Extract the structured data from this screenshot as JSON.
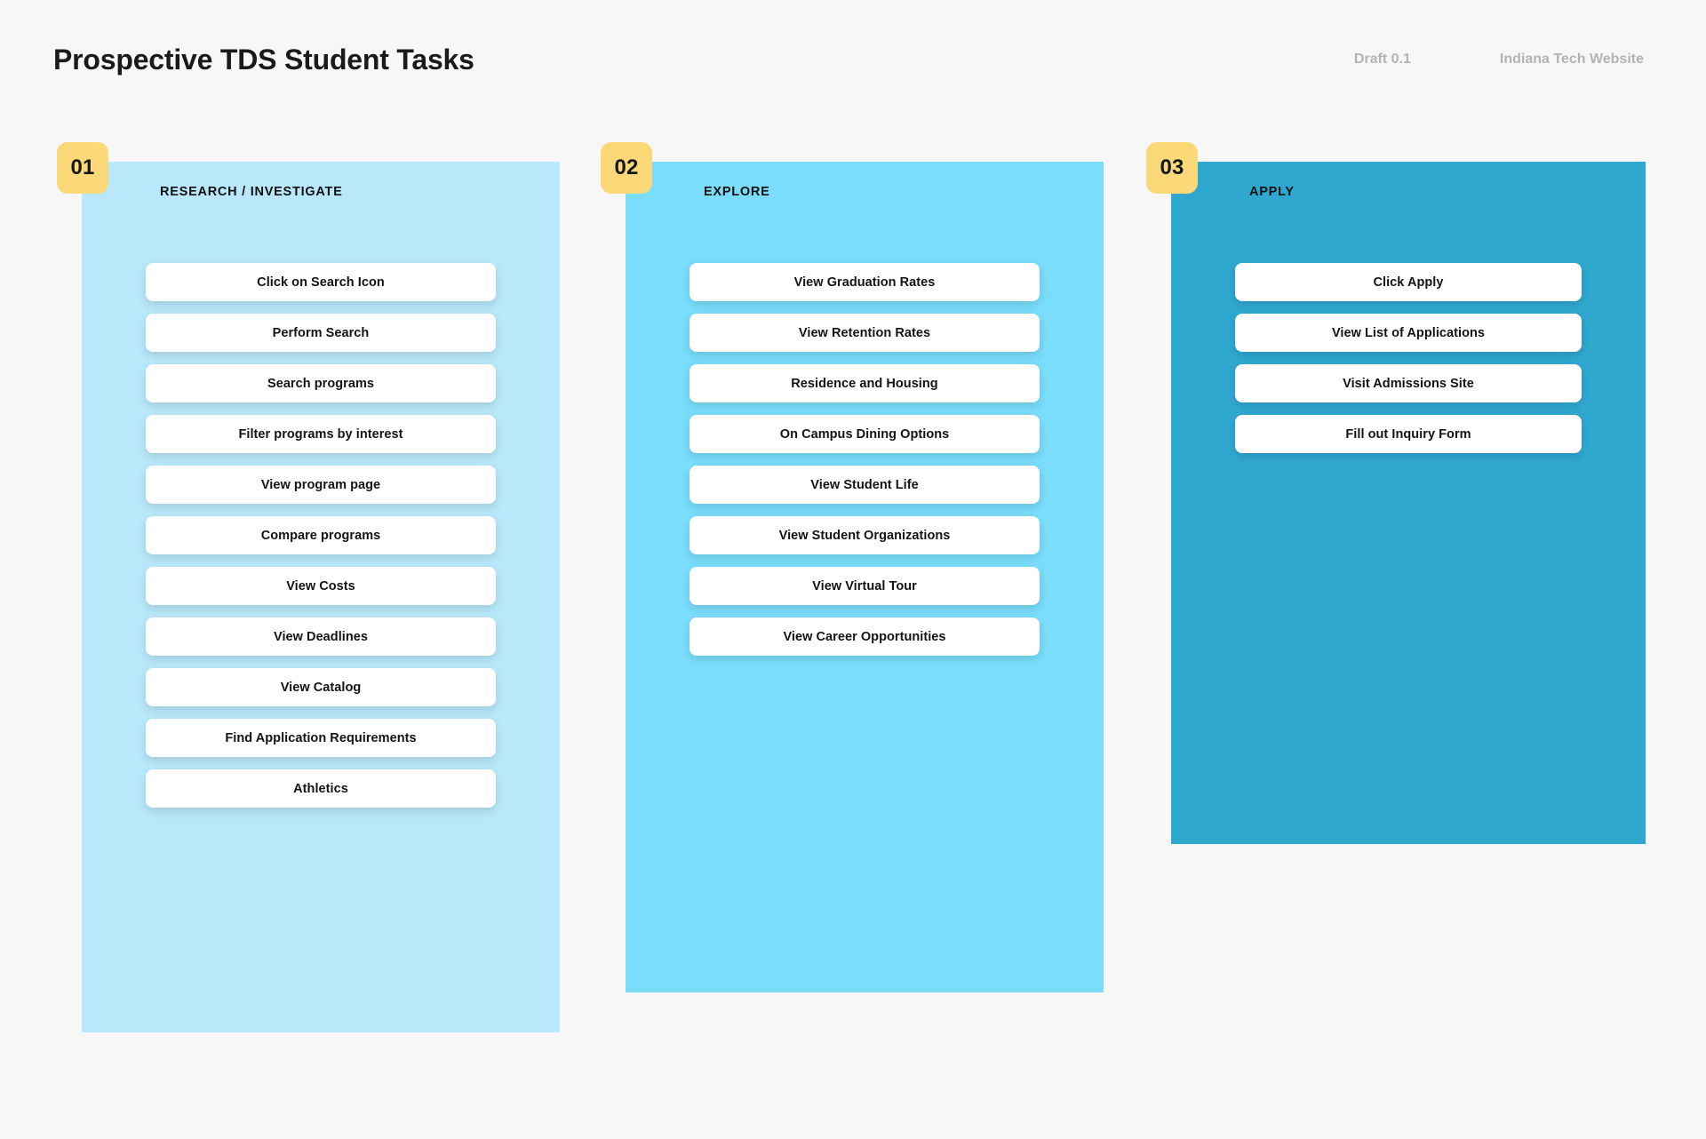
{
  "header": {
    "title": "Prospective TDS Student Tasks",
    "draft_label": "Draft 0.1",
    "project_label": "Indiana Tech Website"
  },
  "columns": [
    {
      "number": "01",
      "heading": "RESEARCH / INVESTIGATE",
      "background_color": "#b8e8fa",
      "badge_color": "#fbd978",
      "tasks": [
        "Click on Search Icon",
        "Perform Search",
        "Search programs",
        "Filter programs by interest",
        "View program page",
        "Compare programs",
        "View Costs",
        "View Deadlines",
        "View Catalog",
        "Find Application Requirements",
        "Athletics"
      ]
    },
    {
      "number": "02",
      "heading": "EXPLORE",
      "background_color": "#79ddfb",
      "badge_color": "#fbd978",
      "tasks": [
        "View Graduation Rates",
        "View Retention Rates",
        "Residence and Housing",
        "On Campus Dining Options",
        "View Student Life",
        "View Student Organizations",
        "View Virtual Tour",
        "View Career Opportunities"
      ]
    },
    {
      "number": "03",
      "heading": "APPLY",
      "background_color": "#2fa8d0",
      "badge_color": "#fbd978",
      "tasks": [
        "Click Apply",
        "View List of Applications",
        "Visit Admissions Site",
        "Fill out Inquiry Form"
      ]
    }
  ],
  "theme": {
    "page_background": "#f7f7f7",
    "card_background": "#ffffff",
    "title_color": "#1a1a1a",
    "meta_color": "#b3b3b3"
  }
}
